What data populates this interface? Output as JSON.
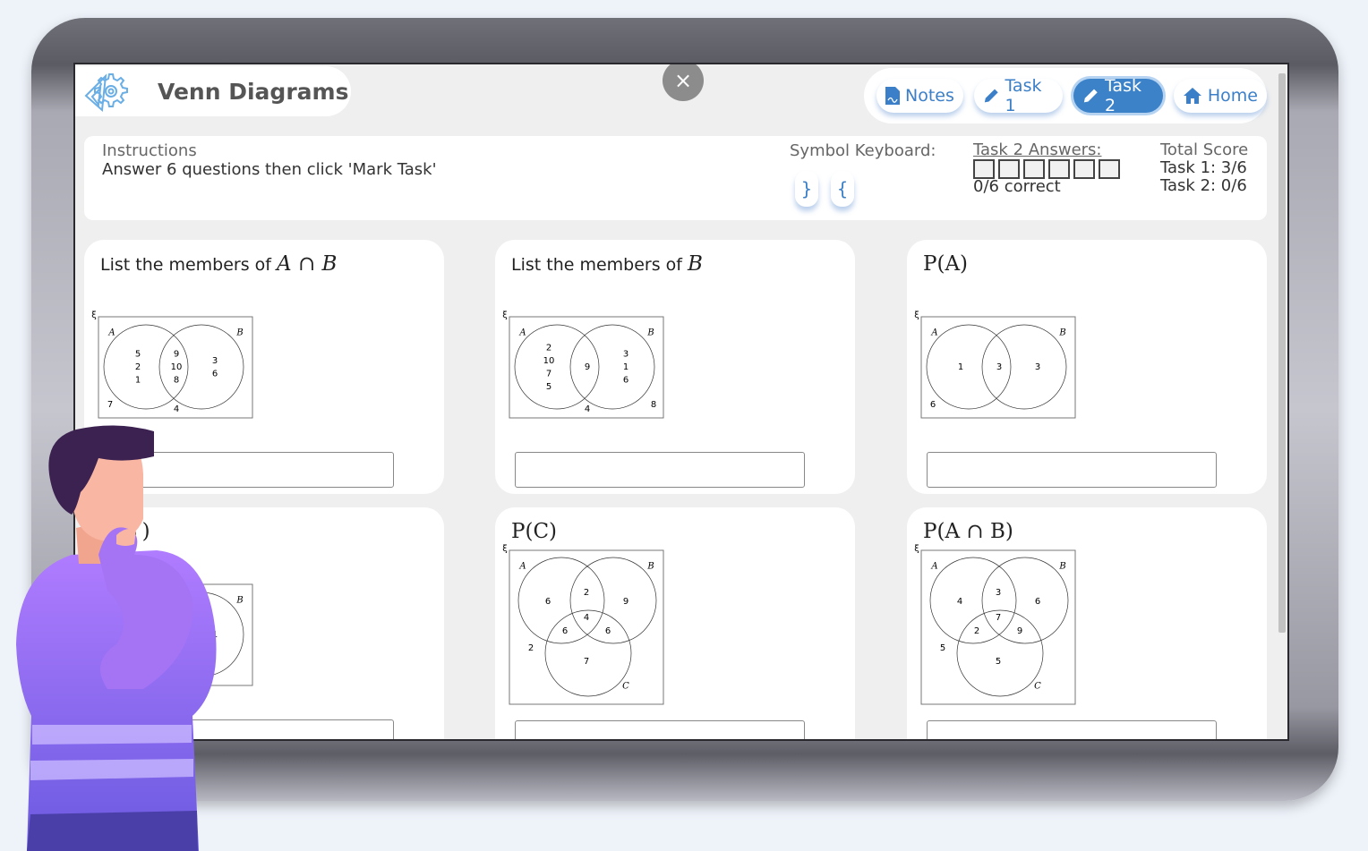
{
  "header": {
    "title": "Venn Diagrams",
    "logo_icon": "gear-ruler-icon",
    "close_icon": "close-icon",
    "close_label": "×"
  },
  "nav": [
    {
      "label": "Notes",
      "icon": "document-icon",
      "active": false
    },
    {
      "label": "Task 1",
      "icon": "pencil-icon",
      "active": false
    },
    {
      "label": "Task 2",
      "icon": "pencil-icon",
      "active": true
    },
    {
      "label": "Home",
      "icon": "home-icon",
      "active": false
    }
  ],
  "accent": "#3b82c9",
  "info": {
    "instructions_label": "Instructions",
    "instructions_text": "Answer 6 questions then click 'Mark Task'",
    "keyboard_label": "Symbol Keyboard:",
    "keys": [
      "}",
      "{"
    ],
    "answers_label": "Task 2 Answers:",
    "answer_boxes": 6,
    "correct_text": "0/6 correct",
    "score_label": "Total Score",
    "score_task1": "Task 1: 3/6",
    "score_task2": "Task 2: 0/6"
  },
  "questions": [
    {
      "prefix": "List the members of ",
      "math": "A ∩ B",
      "input": "",
      "venn": {
        "sets": 2,
        "universal": "ξ",
        "labels": [
          "A",
          "B"
        ],
        "a_only": [
          "5",
          "2",
          "1"
        ],
        "ab": [
          "9",
          "10",
          "8"
        ],
        "b_only": [
          "3",
          "6"
        ],
        "outside": [
          {
            "value": "7",
            "slot": "bottom-left"
          },
          {
            "value": "4",
            "slot": "bottom-center"
          }
        ]
      }
    },
    {
      "prefix": "List the members of ",
      "math": "B",
      "input": "",
      "venn": {
        "sets": 2,
        "universal": "ξ",
        "labels": [
          "A",
          "B"
        ],
        "a_only": [
          "2",
          "10",
          "7",
          "5"
        ],
        "ab": [
          "9"
        ],
        "b_only": [
          "3",
          "1",
          "6"
        ],
        "outside": [
          {
            "value": "4",
            "slot": "bottom-center"
          },
          {
            "value": "8",
            "slot": "bottom-right"
          }
        ]
      }
    },
    {
      "prefix": "",
      "math": "P(A)",
      "input": "",
      "venn": {
        "sets": 2,
        "universal": "ξ",
        "labels": [
          "A",
          "B"
        ],
        "a_only": [
          "1"
        ],
        "ab": [
          "3"
        ],
        "b_only": [
          "3"
        ],
        "outside": [
          {
            "value": "6",
            "slot": "bottom-left"
          }
        ]
      }
    },
    {
      "prefix": "",
      "math": "P(B′)",
      "input": "",
      "venn": {
        "sets": 2,
        "universal": "ξ",
        "labels": [
          "A",
          "B"
        ],
        "a_only": [],
        "ab": [],
        "b_only": [
          "1"
        ],
        "outside": []
      }
    },
    {
      "prefix": "",
      "math": "P(C)",
      "input": "",
      "venn": {
        "sets": 3,
        "universal": "ξ",
        "labels": [
          "A",
          "B",
          "C"
        ],
        "a_only": "6",
        "ab_only": "2",
        "b_only": "9",
        "abc": "4",
        "ac_only": "6",
        "bc_only": "6",
        "c_only": "7",
        "outside": "2"
      }
    },
    {
      "prefix": "",
      "math": "P(A ∩ B)",
      "input": "",
      "venn": {
        "sets": 3,
        "universal": "ξ",
        "labels": [
          "A",
          "B",
          "C"
        ],
        "a_only": "4",
        "ab_only": "3",
        "b_only": "6",
        "abc": "7",
        "ac_only": "2",
        "bc_only": "9",
        "c_only": "5",
        "outside": "5"
      }
    }
  ]
}
